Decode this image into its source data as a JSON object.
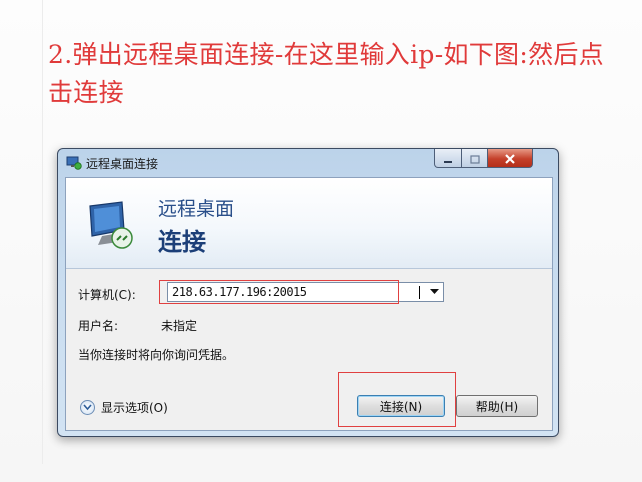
{
  "instruction": {
    "text": "2.弹出远程桌面连接-在这里输入ip-如下图:然后点击连接",
    "color": "#e03a3a"
  },
  "window": {
    "title": "远程桌面连接",
    "icons": {
      "app": "remote-desktop-icon",
      "minimize": "minimize-icon",
      "maximize": "maximize-icon",
      "close": "close-icon"
    },
    "banner": {
      "line1": "远程桌面",
      "line2": "连接",
      "icon": "monitor-connection-icon"
    },
    "computer": {
      "label": "计算机(C):",
      "value": "218.63.177.196:20015",
      "dropdown_icon": "chevron-down-icon"
    },
    "username": {
      "label": "用户名:",
      "value": "未指定"
    },
    "prompt": "当你连接时将向你询问凭据。",
    "options": {
      "label": "显示选项(O)",
      "icon": "chevron-down-circle-icon"
    },
    "buttons": {
      "connect": "连接(N)",
      "help": "帮助(H)"
    },
    "highlight_color": "#e04040"
  }
}
